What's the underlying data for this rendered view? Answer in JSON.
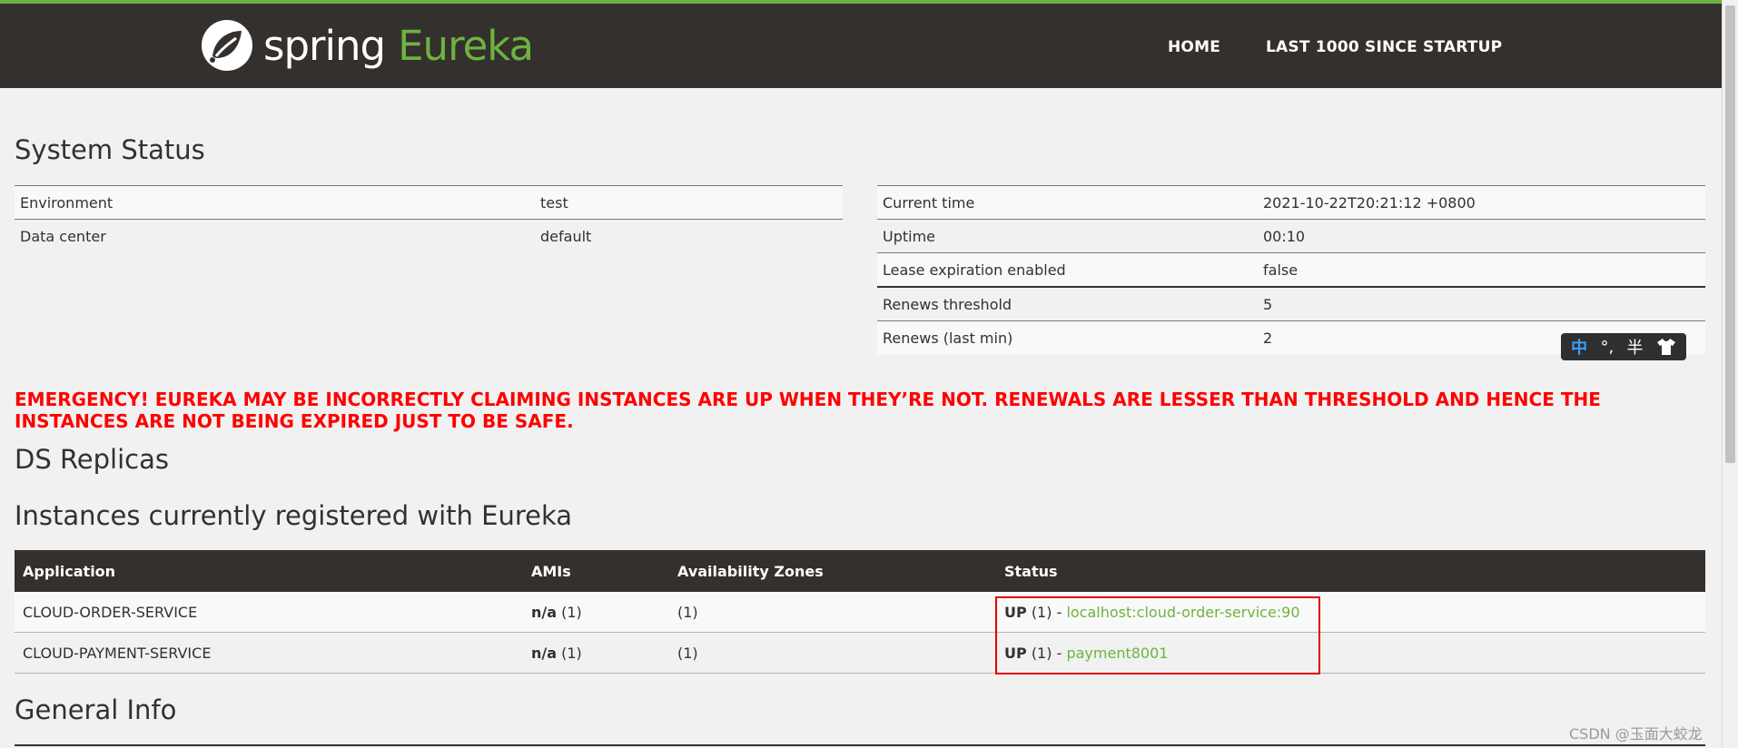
{
  "brand": {
    "spring": "spring",
    "eureka": "Eureka"
  },
  "nav": {
    "home": "HOME",
    "last1000": "LAST 1000 SINCE STARTUP"
  },
  "system_status": {
    "title": "System Status",
    "left": [
      {
        "key": "Environment",
        "value": "test"
      },
      {
        "key": "Data center",
        "value": "default"
      }
    ],
    "right": [
      {
        "key": "Current time",
        "value": "2021-10-22T20:21:12 +0800"
      },
      {
        "key": "Uptime",
        "value": "00:10"
      },
      {
        "key": "Lease expiration enabled",
        "value": "false"
      },
      {
        "key": "Renews threshold",
        "value": "5"
      },
      {
        "key": "Renews (last min)",
        "value": "2"
      }
    ]
  },
  "emergency": "EMERGENCY! EUREKA MAY BE INCORRECTLY CLAIMING INSTANCES ARE UP WHEN THEY’RE NOT. RENEWALS ARE LESSER THAN THRESHOLD AND HENCE THE INSTANCES ARE NOT BEING EXPIRED JUST TO BE SAFE.",
  "ds_replicas": {
    "title": "DS Replicas"
  },
  "instances": {
    "title": "Instances currently registered with Eureka",
    "headers": [
      "Application",
      "AMIs",
      "Availability Zones",
      "Status"
    ],
    "rows": [
      {
        "app": "CLOUD-ORDER-SERVICE",
        "ami_bold": "n/a",
        "ami_count": "(1)",
        "zones": "(1)",
        "status": "UP",
        "status_count": "(1)",
        "sep": "-",
        "instance": "localhost:cloud-order-service:90"
      },
      {
        "app": "CLOUD-PAYMENT-SERVICE",
        "ami_bold": "n/a",
        "ami_count": "(1)",
        "zones": "(1)",
        "status": "UP",
        "status_count": "(1)",
        "sep": "-",
        "instance": "payment8001"
      }
    ]
  },
  "general_info": {
    "title": "General Info"
  },
  "ime": {
    "lang": "中",
    "punct": "°,",
    "width": "半",
    "skin_icon": "shirt-icon"
  },
  "watermark": "CSDN @玉面大蛟龙",
  "colors": {
    "navbar": "#34302d",
    "accent": "#6db33f",
    "emergency": "#ff0000",
    "highlight_box": "#e00000"
  }
}
